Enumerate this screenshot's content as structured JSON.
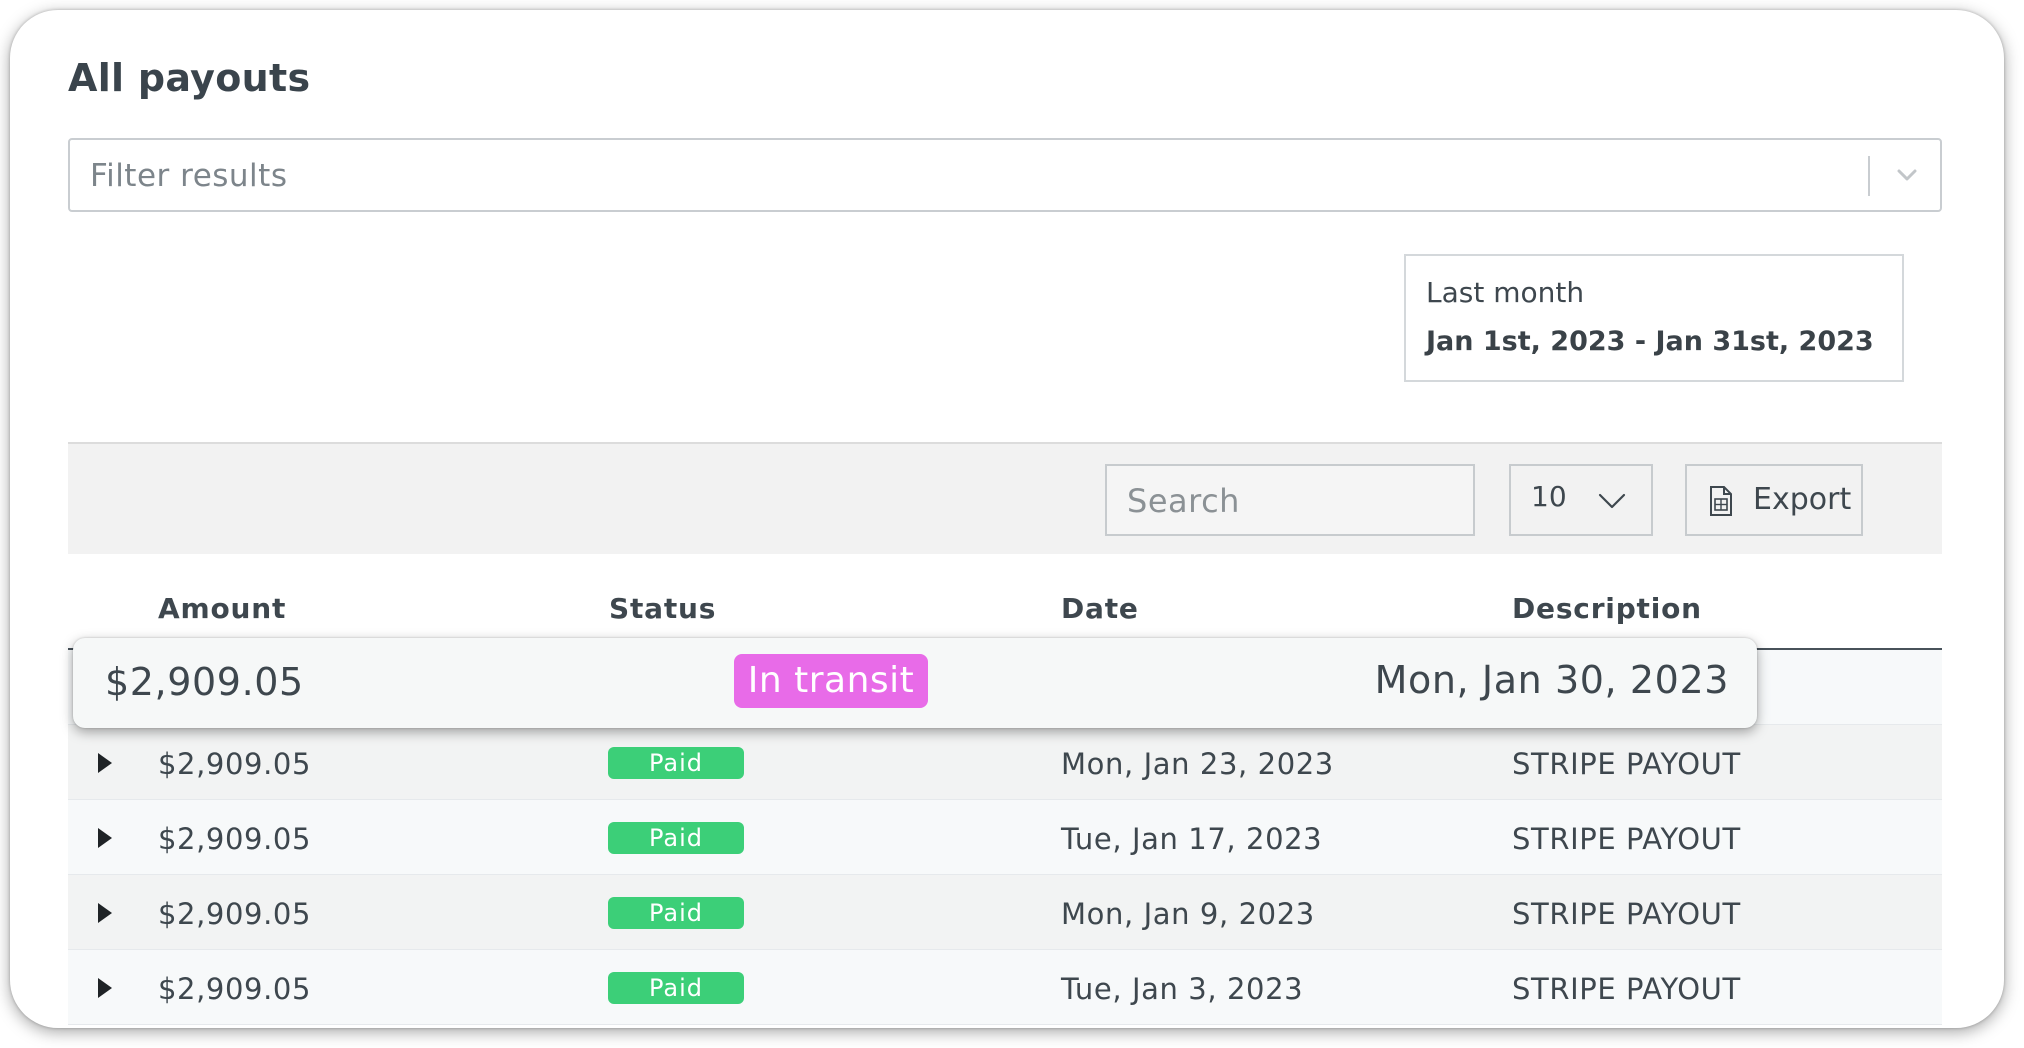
{
  "page": {
    "title": "All payouts"
  },
  "filter": {
    "placeholder": "Filter results"
  },
  "date_range": {
    "label": "Last month",
    "value": "Jan 1st, 2023 - Jan 31st, 2023"
  },
  "toolbar": {
    "search_placeholder": "Search",
    "page_size": "10",
    "export_label": "Export"
  },
  "table": {
    "columns": [
      "Amount",
      "Status",
      "Date",
      "Description"
    ],
    "highlighted_row": {
      "amount": "$2,909.05",
      "status": "In transit",
      "date": "Mon, Jan 30, 2023"
    },
    "rows": [
      {
        "amount": "$2,909.05",
        "status": "Paid",
        "date": "Mon, Jan 23, 2023",
        "description": "STRIPE PAYOUT"
      },
      {
        "amount": "$2,909.05",
        "status": "Paid",
        "date": "Tue, Jan 17, 2023",
        "description": "STRIPE PAYOUT"
      },
      {
        "amount": "$2,909.05",
        "status": "Paid",
        "date": "Mon, Jan 9, 2023",
        "description": "STRIPE PAYOUT"
      },
      {
        "amount": "$2,909.05",
        "status": "Paid",
        "date": "Tue, Jan 3, 2023",
        "description": "STRIPE PAYOUT"
      }
    ]
  },
  "colors": {
    "paid_badge": "#3ccf78",
    "in_transit_badge": "#e86be8"
  },
  "icons": {
    "filter_dropdown": "chevron-down-icon",
    "page_size_dropdown": "chevron-down-icon",
    "export": "spreadsheet-icon",
    "row_expand": "caret-right-icon"
  }
}
